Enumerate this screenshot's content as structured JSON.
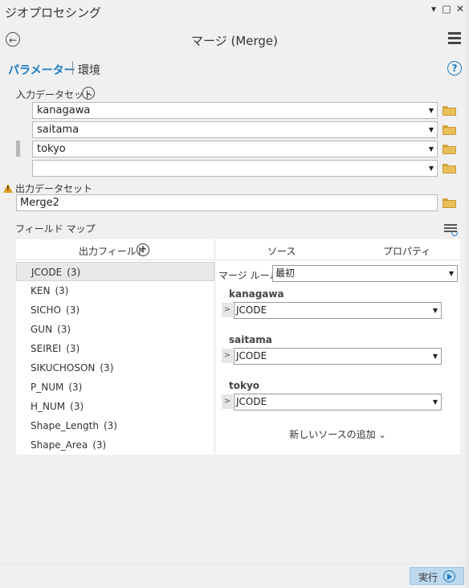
{
  "pane": {
    "title": "ジオプロセシング",
    "controls": [
      "▾",
      "□",
      "✕"
    ]
  },
  "header": {
    "back_label": "←",
    "title": "マージ (Merge)"
  },
  "tabs": {
    "parameters": "パラメーター",
    "environments": "環境",
    "help": "?"
  },
  "input": {
    "label": "入力データセット",
    "expand_icon": "⌄",
    "datasets": [
      "kanagawa",
      "saitama",
      "tokyo",
      ""
    ]
  },
  "output": {
    "label": "出力データセット",
    "value": "Merge2"
  },
  "field_map": {
    "label": "フィールド マップ",
    "output_fields_header": "出力フィールド",
    "add_label": "+",
    "tab_sources": "ソース",
    "tab_properties": "プロパティ",
    "fields": [
      {
        "name": "JCODE",
        "count": "(3)"
      },
      {
        "name": "KEN",
        "count": "(3)"
      },
      {
        "name": "SICHO",
        "count": "(3)"
      },
      {
        "name": "GUN",
        "count": "(3)"
      },
      {
        "name": "SEIREI",
        "count": "(3)"
      },
      {
        "name": "SIKUCHOSON",
        "count": "(3)"
      },
      {
        "name": "P_NUM",
        "count": "(3)"
      },
      {
        "name": "H_NUM",
        "count": "(3)"
      },
      {
        "name": "Shape_Length",
        "count": "(3)"
      },
      {
        "name": "Shape_Area",
        "count": "(3)"
      }
    ],
    "merge_rule_label": "マージ ルール",
    "merge_rule_value": "最初",
    "sources": [
      {
        "name": "kanagawa",
        "field": "JCODE"
      },
      {
        "name": "saitama",
        "field": "JCODE"
      },
      {
        "name": "tokyo",
        "field": "JCODE"
      }
    ],
    "add_source_label": "新しいソースの追加",
    "add_source_chevron": "⌄"
  },
  "run_button": {
    "label": "実行"
  },
  "colors": {
    "accent": "#1a7bc2",
    "folder": "#e8c05a",
    "warning": "#e0a020",
    "run_button_bg": "#bcd9ee"
  }
}
